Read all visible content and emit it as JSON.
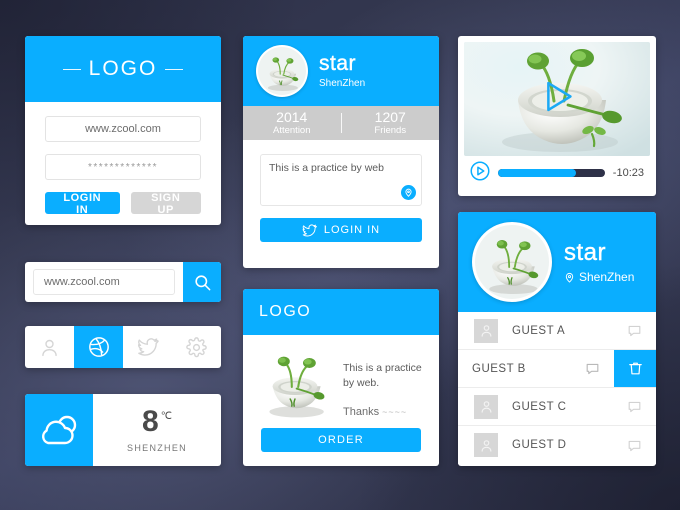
{
  "theme": {
    "accent": "#0aaeff",
    "grey": "#cccccc",
    "card_bg": "#ffffff",
    "bg_dark": "#2c2f47"
  },
  "login_card": {
    "logo": "LOGO",
    "username_value": "www.zcool.com",
    "password_value": "*************",
    "login_button": "LOGIN IN",
    "signup_button": "SIGN UP"
  },
  "search_card": {
    "value": "www.zcool.com",
    "placeholder": "www.zcool.com",
    "icon": "search-icon"
  },
  "toolbar_card": {
    "items": [
      {
        "icon": "user-icon",
        "active": false
      },
      {
        "icon": "dribbble-icon",
        "active": true
      },
      {
        "icon": "twitter-icon",
        "active": false
      },
      {
        "icon": "gear-icon",
        "active": false
      }
    ]
  },
  "weather_card": {
    "icon": "cloud-sun-icon",
    "temperature": "8",
    "unit": "℃",
    "city": "SHENZHEN"
  },
  "star_card": {
    "avatar": "plant-bowl-avatar",
    "name": "star",
    "location": "ShenZhen",
    "stats": [
      {
        "value": "2014",
        "label": "Attention"
      },
      {
        "value": "1207",
        "label": "Friends"
      }
    ],
    "note_text": "This is a practice by web",
    "note_badge_icon": "location-pin-icon",
    "login_button": "LOGIN IN",
    "login_button_icon": "twitter-icon"
  },
  "order_card": {
    "logo": "LOGO",
    "illustration": "plant-bowl-illustration",
    "body_line1": "This is a practice",
    "body_line2": "by web.",
    "thanks": "Thanks",
    "thanks_tilde": "~~~~",
    "order_button": "ORDER"
  },
  "video_card": {
    "thumbnail": "plant-bowl-photo",
    "overlay_icon": "play-triangle-icon",
    "play_button_icon": "play-circle-icon",
    "progress_percent": 73,
    "time_remaining": "-10:23"
  },
  "guest_card": {
    "avatar": "plant-bowl-avatar",
    "name": "star",
    "location": "ShenZhen",
    "location_icon": "location-pin-icon",
    "rows": [
      {
        "name": "GUEST A",
        "avatar_icon": "user-icon",
        "chat_icon": "chat-bubble-icon",
        "swiped": false,
        "delete_label": ""
      },
      {
        "name": "GUEST B",
        "avatar_icon": "user-icon",
        "chat_icon": "chat-bubble-icon",
        "swiped": true,
        "delete_label": "trash-icon"
      },
      {
        "name": "GUEST C",
        "avatar_icon": "user-icon",
        "chat_icon": "chat-bubble-icon",
        "swiped": false,
        "delete_label": ""
      },
      {
        "name": "GUEST D",
        "avatar_icon": "user-icon",
        "chat_icon": "chat-bubble-icon",
        "swiped": false,
        "delete_label": ""
      }
    ]
  }
}
